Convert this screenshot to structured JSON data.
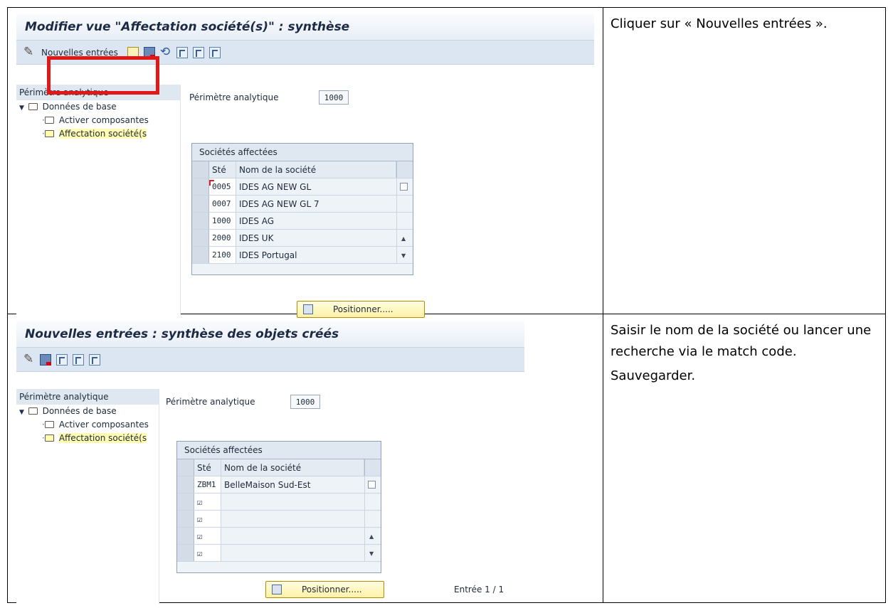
{
  "instructions": {
    "step1": "Cliquer sur « Nouvelles entrées ».",
    "step2_line1": "Saisir le nom de la société ou lancer une recherche via le match code.",
    "step2_line2": "Sauvegarder."
  },
  "screen1": {
    "title": "Modifier vue \"Affectation société(s)\" : synthèse",
    "toolbar": {
      "new_entries_label": "Nouvelles entrées",
      "icons": [
        "pencil-icon",
        "copy-icon",
        "delete-icon",
        "undo-icon",
        "select-all-icon",
        "select-block-icon",
        "deselect-all-icon"
      ]
    },
    "tree": {
      "header": "Périmètre analytique",
      "root": "Données de base",
      "item1": "Activer composantes",
      "item2": "Affectation société(s"
    },
    "field_label": "Périmètre analytique",
    "field_value": "1000",
    "grid": {
      "title": "Sociétés affectées",
      "col_code": "Sté",
      "col_name": "Nom de la société",
      "rows": [
        {
          "code": "0005",
          "name": "IDES AG NEW GL"
        },
        {
          "code": "0007",
          "name": "IDES AG NEW GL 7"
        },
        {
          "code": "1000",
          "name": "IDES AG"
        },
        {
          "code": "2000",
          "name": "IDES UK"
        },
        {
          "code": "2100",
          "name": "IDES Portugal"
        }
      ]
    },
    "position_button": "Positionner....."
  },
  "screen2": {
    "title": "Nouvelles entrées : synthèse des objets créés",
    "tree": {
      "header": "Périmètre analytique",
      "root": "Données de base",
      "item1": "Activer composantes",
      "item2": "Affectation société(s"
    },
    "field_label": "Périmètre analytique",
    "field_value": "1000",
    "grid": {
      "title": "Sociétés affectées",
      "col_code": "Sté",
      "col_name": "Nom de la société",
      "rows": [
        {
          "code": "ZBM1",
          "name": "BelleMaison Sud-Est"
        },
        {
          "code": "☑",
          "name": ""
        },
        {
          "code": "☑",
          "name": ""
        },
        {
          "code": "☑",
          "name": ""
        },
        {
          "code": "☑",
          "name": ""
        }
      ]
    },
    "position_button": "Positionner.....",
    "entry_counter": "Entrée 1 / 1"
  },
  "colors": {
    "highlight": "#e01818",
    "toolbar_bg": "#dbe6f2",
    "selected_tree_bg": "#fffbb0"
  }
}
